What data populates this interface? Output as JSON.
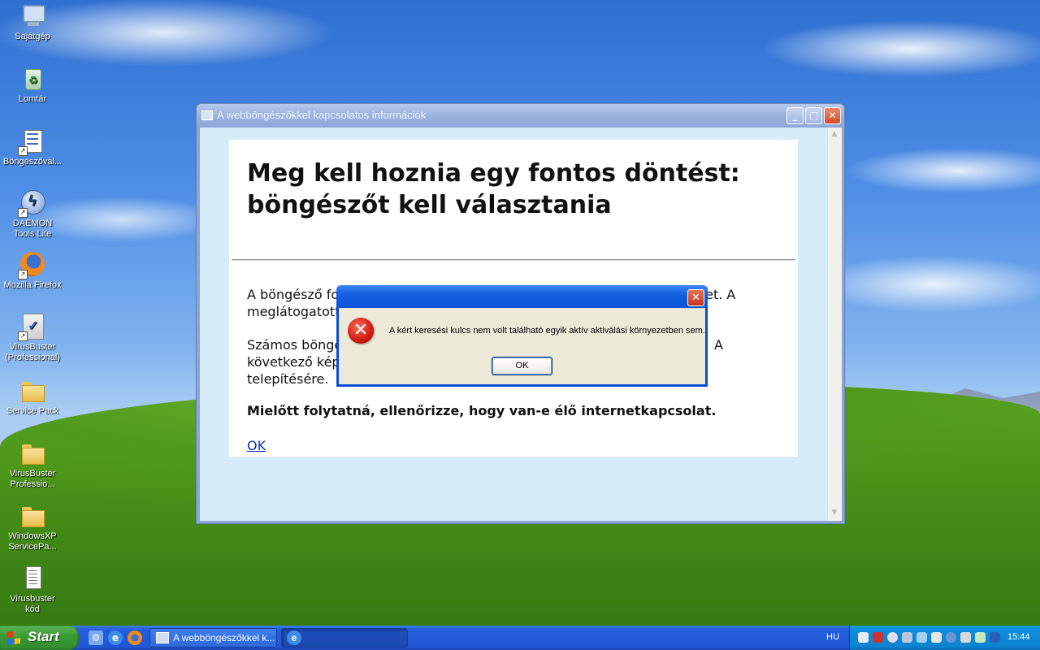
{
  "desktop": {
    "icons": [
      {
        "label": "Sajátgép",
        "icon": "my-computer-icon"
      },
      {
        "label": "Lomtár",
        "icon": "recycle-bin-icon"
      },
      {
        "label": "Böngészővál...",
        "icon": "browser-choice-icon"
      },
      {
        "label": "DAEMON Tools Lite",
        "icon": "daemon-tools-icon"
      },
      {
        "label": "Mozilla Firefox",
        "icon": "firefox-icon"
      },
      {
        "label": "VirusBuster (Professional)",
        "icon": "virusbuster-icon"
      },
      {
        "label": "Service Pack",
        "icon": "folder-icon"
      },
      {
        "label": "VirusBuster Professio...",
        "icon": "folder-icon"
      },
      {
        "label": "WindowsXP ServicePa...",
        "icon": "folder-icon"
      },
      {
        "label": "Virusbuster kód",
        "icon": "text-document-icon"
      }
    ]
  },
  "main_window": {
    "title": "A webböngészőkkel kapcsolatos információk",
    "heading": "Meg kell hoznia egy fontos döntést: böngészőt kell választania",
    "para1_line1": "A böngésző for",
    "para1_line1_end": "net. A",
    "para1_line2": "meglátogatott",
    "para2_line1": "Számos böngés",
    "para2_line1_end": "A",
    "para2_line2": "következő képe",
    "para2_line3": "telepítésére.",
    "warning": "Mielőtt folytatná, ellenőrizze, hogy van-e élő internetkapcsolat.",
    "ok_link": "OK"
  },
  "error_dialog": {
    "message": "A kért keresési kulcs nem volt található egyik aktív aktiválási környezetben sem.",
    "ok_label": "OK"
  },
  "taskbar": {
    "start_label": "Start",
    "tasks": [
      {
        "label": "A webböngészőkkel k..."
      },
      {
        "label": ""
      }
    ],
    "language": "HU",
    "clock": "15:44"
  },
  "colors": {
    "taskbar_blue": "#245edb",
    "start_green": "#3c9b37",
    "dialog_title_blue": "#0b54d9",
    "dialog_face": "#ece9d8",
    "content_bg": "#d6edf9",
    "link_blue": "#0b2eb8"
  }
}
